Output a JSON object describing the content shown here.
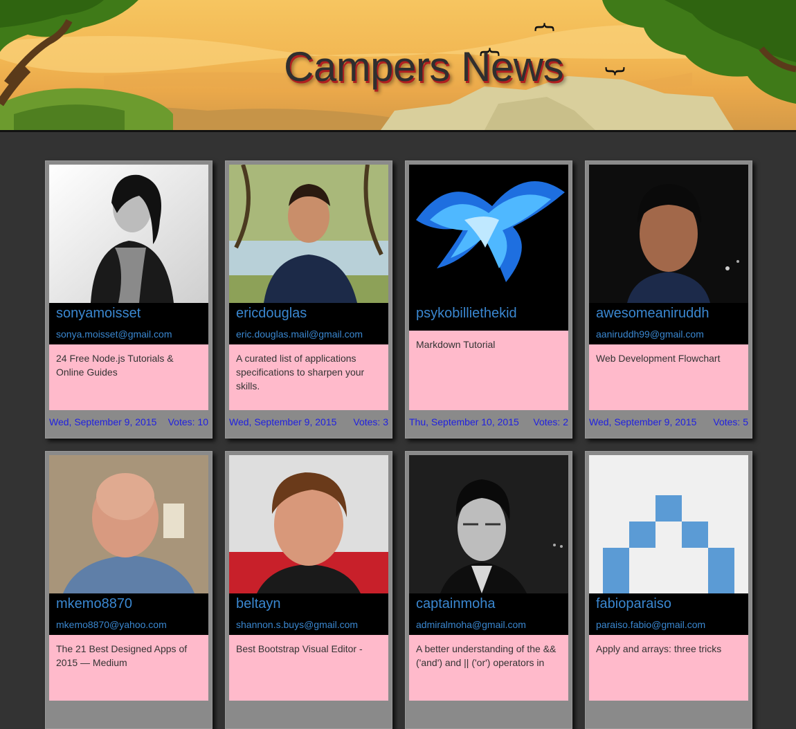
{
  "header": {
    "title": "Campers News"
  },
  "posts": [
    {
      "username": "sonyamoisset",
      "email": "sonya.moisset@gmail.com",
      "headline": "24 Free Node.js Tutorials & Online Guides",
      "date": "Wed, September 9, 2015",
      "votes": "Votes: 10",
      "avatar": "woman-portrait-bw"
    },
    {
      "username": "ericdouglas",
      "email": "eric.douglas.mail@gmail.com",
      "headline": "A curated list of applications specifications to sharpen your skills.",
      "date": "Wed, September 9, 2015",
      "votes": "Votes: 3",
      "avatar": "man-always-keep-shipping-shirt"
    },
    {
      "username": "psykobilliethekid",
      "email": "",
      "headline": "Markdown Tutorial",
      "date": "Thu, September 10, 2015",
      "votes": "Votes: 2",
      "avatar": "blue-phoenix"
    },
    {
      "username": "awesomeaniruddh",
      "email": "aaniruddh99@gmail.com",
      "headline": "Web Development Flowchart",
      "date": "Wed, September 9, 2015",
      "votes": "Votes: 5",
      "avatar": "young-man-night"
    },
    {
      "username": "mkemo8870",
      "email": "mkemo8870@yahoo.com",
      "headline": "The 21 Best Designed Apps of 2015 — Medium",
      "date": "",
      "votes": "",
      "avatar": "bald-man"
    },
    {
      "username": "beltayn",
      "email": "shannon.s.buys@gmail.com",
      "headline": "Best Bootstrap Visual Editor -",
      "date": "",
      "votes": "",
      "avatar": "man-portrait"
    },
    {
      "username": "captainmoha",
      "email": "admiralmoha@gmail.com",
      "headline": "A better understanding of the && ('and') and || ('or') operators in",
      "date": "",
      "votes": "",
      "avatar": "man-glasses-bw"
    },
    {
      "username": "fabioparaiso",
      "email": "paraiso.fabio@gmail.com",
      "headline": "Apply and arrays: three tricks",
      "date": "",
      "votes": "",
      "avatar": "blue-pixel-identicon"
    }
  ]
}
